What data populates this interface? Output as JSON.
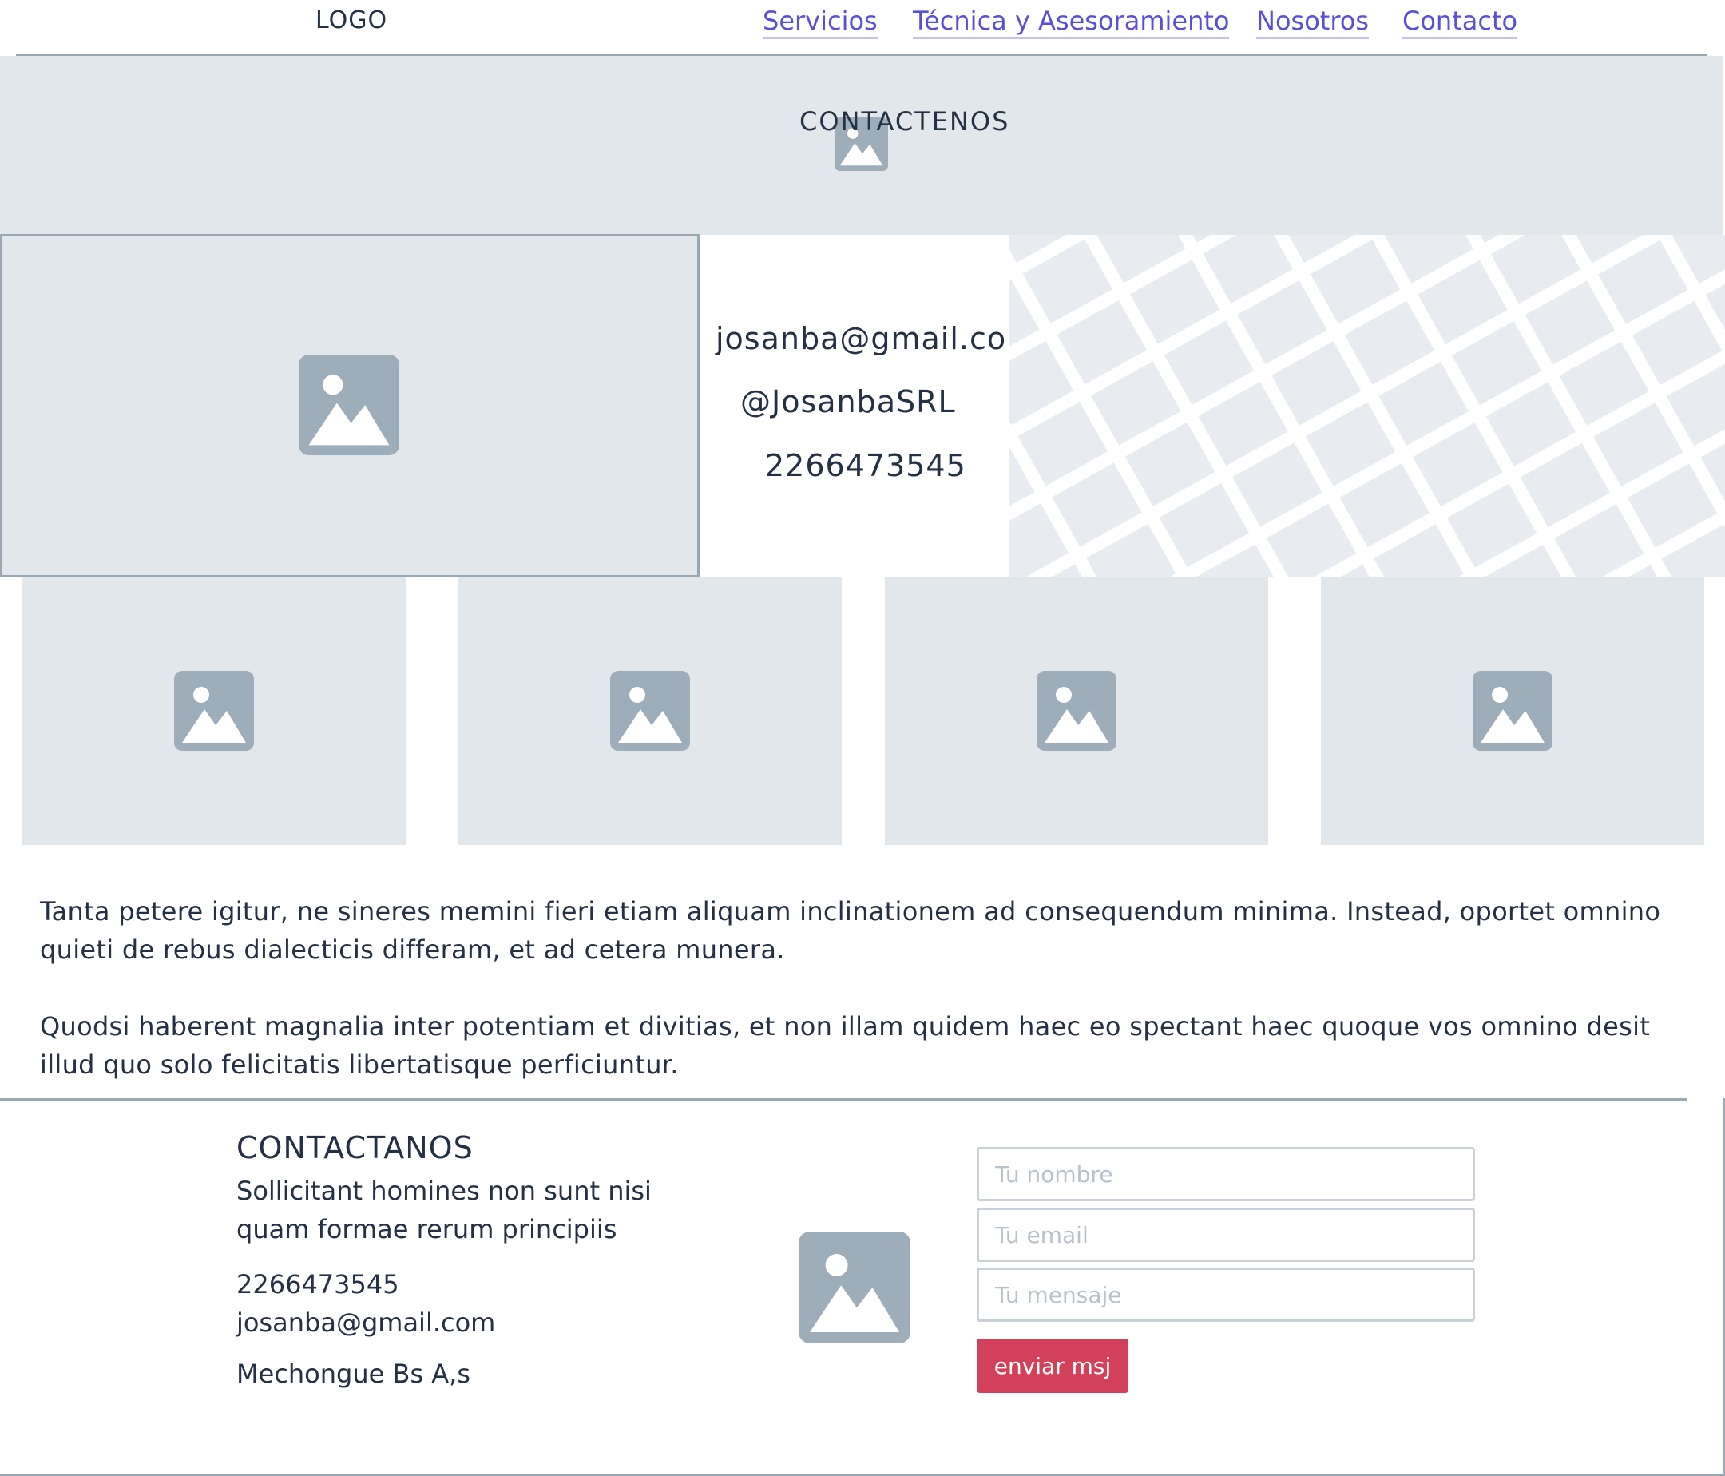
{
  "header": {
    "logo": "LOGO",
    "nav": [
      {
        "label": "Servicios"
      },
      {
        "label": "Técnica y Asesoramiento"
      },
      {
        "label": "Nosotros"
      },
      {
        "label": "Contacto"
      }
    ]
  },
  "banner": {
    "title": "CONTACTENOS",
    "icon": "image-placeholder-icon"
  },
  "hero": {
    "image_icon": "image-placeholder-icon",
    "email": "josanba@gmail.com",
    "social": "@JosanbaSRL",
    "phone": "2266473545",
    "map_icon": "map-placeholder"
  },
  "gallery": [
    {
      "icon": "image-placeholder-icon"
    },
    {
      "icon": "image-placeholder-icon"
    },
    {
      "icon": "image-placeholder-icon"
    },
    {
      "icon": "image-placeholder-icon"
    }
  ],
  "paragraphs": [
    "Tanta petere igitur, ne sineres memini fieri etiam aliquam inclinationem ad consequendum minima. Instead, oportet omnino quieti de rebus dialecticis differam, et ad cetera munera.",
    "Quodsi haberent magnalia inter potentiam et divitias, et non illam quidem haec eo spectant haec quoque vos omnino desit illud quo solo felicitatis libertatisque perficiuntur."
  ],
  "footer": {
    "title": "CONTACTANOS",
    "tagline_line1": "Sollicitant homines non sunt nisi",
    "tagline_line2": "quam formae rerum principiis",
    "phone": "2266473545",
    "email": "josanba@gmail.com",
    "address": "Mechongue Bs A,s",
    "image_icon": "image-placeholder-icon",
    "form": {
      "name_placeholder": "Tu nombre",
      "email_placeholder": "Tu email",
      "message_placeholder": "Tu mensaje",
      "submit_label": "enviar msj"
    }
  },
  "colors": {
    "accent_link": "#5a4fd8",
    "button": "#d3405a",
    "placeholder_bg": "#e2e7ec",
    "placeholder_icon": "#9eadba",
    "rule": "#9aa8b4"
  }
}
